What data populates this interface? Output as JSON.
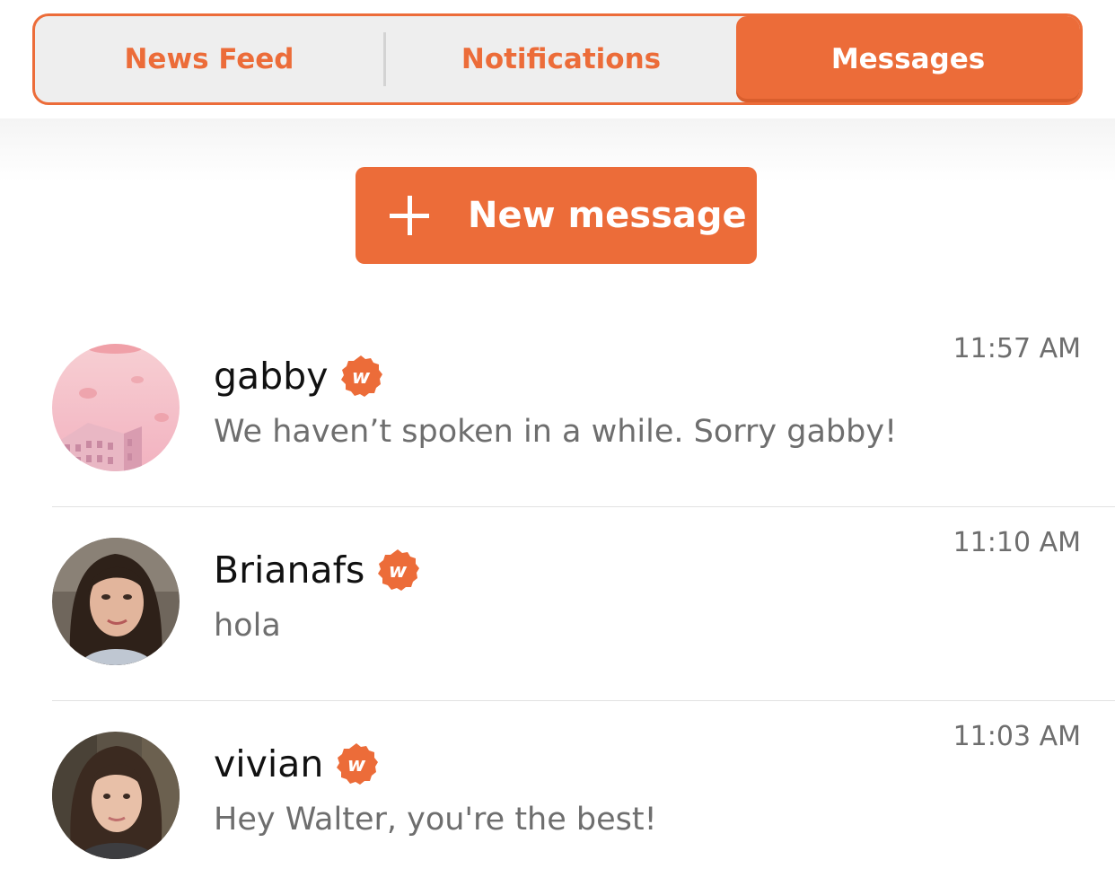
{
  "tabs": [
    {
      "label": "News Feed",
      "active": false
    },
    {
      "label": "Notifications",
      "active": false
    },
    {
      "label": "Messages",
      "active": true
    }
  ],
  "new_message": {
    "label": "New message",
    "icon": "plus-icon"
  },
  "colors": {
    "accent": "#ec6c39",
    "tab_bg": "#eeeeee",
    "muted_text": "#6e6e6e"
  },
  "conversations": [
    {
      "name": "gabby",
      "badge_icon": "verified-w-badge-icon",
      "preview": "We haven’t spoken in a while. Sorry gabby!",
      "time": "11:57 AM",
      "avatar": "pink-building-avatar"
    },
    {
      "name": "Brianafs",
      "badge_icon": "verified-w-badge-icon",
      "preview": "hola",
      "time": "11:10 AM",
      "avatar": "portrait-avatar"
    },
    {
      "name": "vivian",
      "badge_icon": "verified-w-badge-icon",
      "preview": "Hey Walter, you're the best!",
      "time": "11:03 AM",
      "avatar": "portrait-avatar"
    }
  ]
}
